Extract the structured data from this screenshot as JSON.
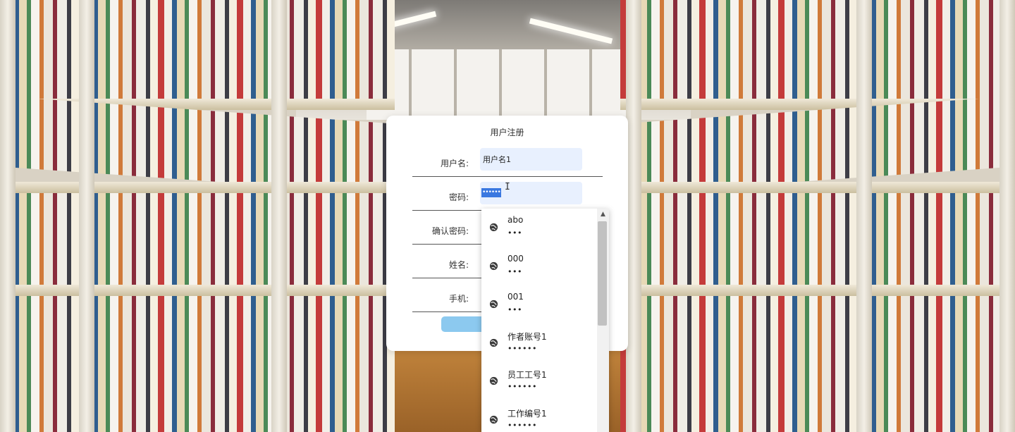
{
  "form": {
    "title": "用户注册",
    "fields": [
      {
        "label": "用户名:",
        "value": "用户名1"
      },
      {
        "label": "密码:",
        "value": "••••••"
      },
      {
        "label": "确认密码:",
        "value": ""
      },
      {
        "label": "姓名:",
        "value": ""
      },
      {
        "label": "手机:",
        "value": ""
      }
    ]
  },
  "autofill": {
    "items": [
      {
        "username": "abo",
        "password": "•••",
        "icon": "globe-icon"
      },
      {
        "username": "000",
        "password": "•••",
        "icon": "globe-icon"
      },
      {
        "username": "001",
        "password": "•••",
        "icon": "globe-icon"
      },
      {
        "username": "作者账号1",
        "password": "••••••",
        "icon": "globe-icon"
      },
      {
        "username": "员工工号1",
        "password": "••••••",
        "icon": "globe-icon"
      },
      {
        "username": "工作编号1",
        "password": "••••••",
        "icon": "globe-icon"
      }
    ]
  },
  "colors": {
    "autofill_bg": "#e8f0fe",
    "selection": "#3a78e0",
    "submit_button": "#8cc9ef"
  }
}
